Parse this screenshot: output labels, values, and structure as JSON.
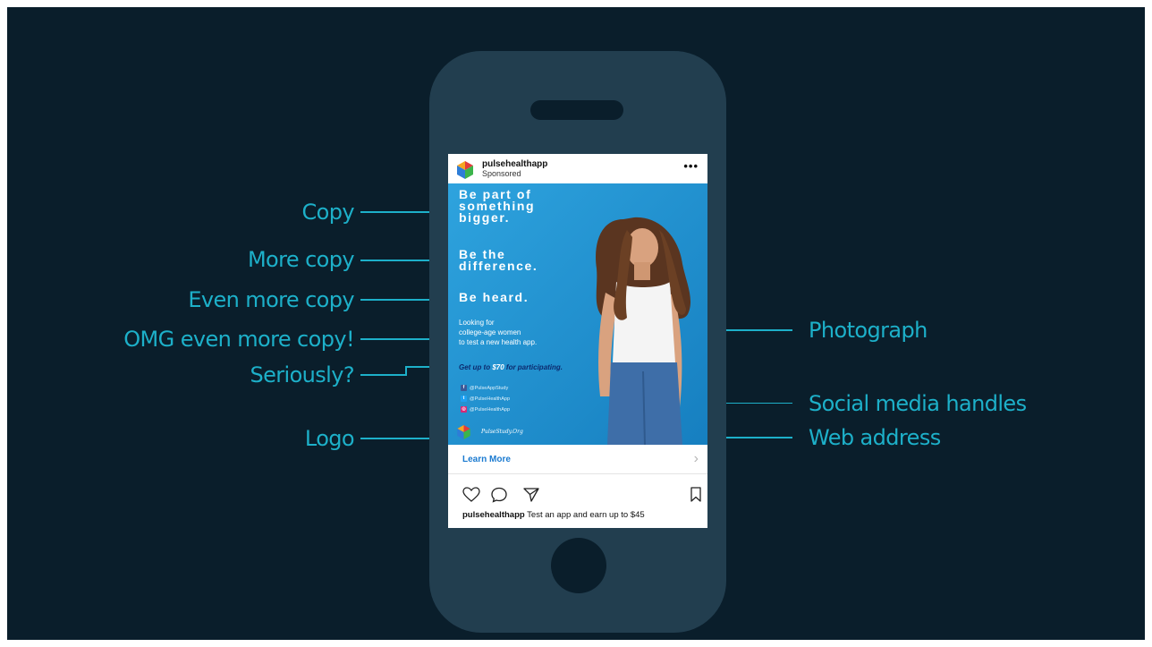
{
  "labels": {
    "copy": "Copy",
    "more_copy": "More copy",
    "even_more_copy": "Even more copy",
    "omg": "OMG even more copy!",
    "seriously": "Seriously?",
    "logo": "Logo",
    "photograph": "Photograph",
    "social": "Social media handles",
    "web": "Web address"
  },
  "post": {
    "username": "pulsehealthapp",
    "sponsored": "Sponsored",
    "more": "•••",
    "headline1": [
      "Be part of",
      "something",
      "bigger."
    ],
    "headline2": [
      "Be the",
      "difference."
    ],
    "headline3": "Be heard.",
    "body": [
      "Looking for",
      "college-age women",
      "to test a new health app."
    ],
    "cta_pre": "Get up to ",
    "cta_amount": "$70",
    "cta_post": " for participating.",
    "social": [
      {
        "icon": "facebook-icon",
        "glyph": "f",
        "color": "#3b5998",
        "handle": "@PulseAppStudy"
      },
      {
        "icon": "twitter-icon",
        "glyph": "t",
        "color": "#1da1f2",
        "handle": "@PulseHealthApp"
      },
      {
        "icon": "instagram-icon",
        "glyph": "◎",
        "color": "#d62976",
        "handle": "@PulseHealthApp"
      }
    ],
    "web": "PulseStudy.Org",
    "learn_more": "Learn More",
    "chevron": "›",
    "caption_user": "pulsehealthapp",
    "caption_text": " Test an app and earn up to $45"
  },
  "colors": {
    "background": "#0a1e2b",
    "phone": "#223e4f",
    "accent": "#1db0c9",
    "ad_blue": "#1d93d2"
  }
}
